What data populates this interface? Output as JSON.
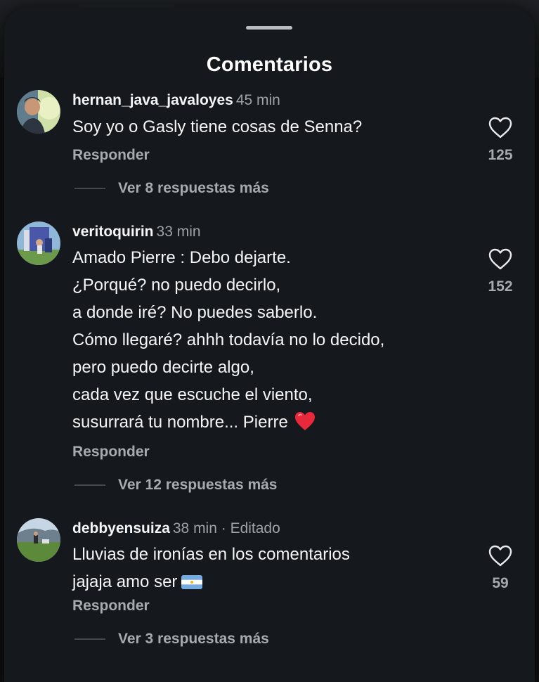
{
  "sheet": {
    "title": "Comentarios"
  },
  "comments": [
    {
      "username": "hernan_java_javaloyes",
      "time": "45 min",
      "lines": [
        "Soy yo o Gasly tiene cosas de Senna?"
      ],
      "reply_label": "Responder",
      "likes": "125",
      "more_replies": "Ver 8 respuestas más"
    },
    {
      "username": "veritoquirin",
      "time": "33 min",
      "lines": [
        "Amado Pierre : Debo dejarte.",
        "¿Porqué? no puedo decirlo,",
        "a donde iré? No puedes saberlo.",
        "Cómo llegaré? ahhh todavía no lo decido,",
        "pero puedo decirte algo,",
        "cada vez que escuche el viento,",
        "susurrará tu nombre... Pierre"
      ],
      "reply_label": "Responder",
      "likes": "152",
      "more_replies": "Ver 12 respuestas más"
    },
    {
      "username": "debbyensuiza",
      "time": "38 min · Editado",
      "lines": [
        "Lluvias de ironías en los comentarios",
        "jajaja amo ser"
      ],
      "reply_label": "Responder",
      "likes": "59",
      "more_replies": "Ver 3 respuestas más"
    }
  ],
  "colors": {
    "sheet_bg": "#15181c",
    "text_primary": "#f3f5f6",
    "text_secondary": "#a6abb0",
    "heart_emoji": "#e8293b",
    "flag_blue": "#74acdf"
  },
  "icons": {
    "like": "heart-outline-icon",
    "emoji_heart": "red-heart-emoji",
    "emoji_flag": "argentina-flag-emoji"
  }
}
